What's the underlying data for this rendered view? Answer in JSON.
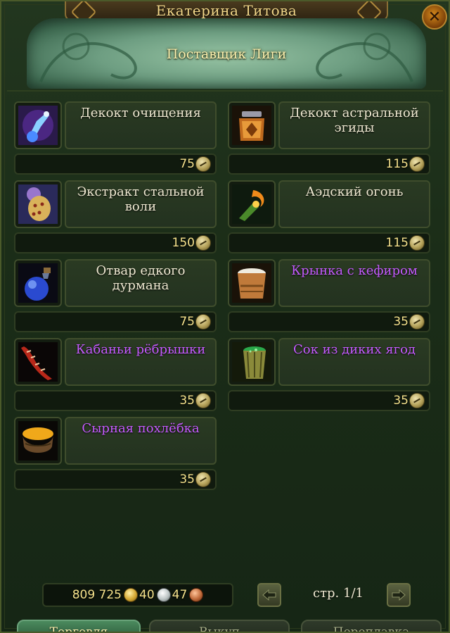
{
  "window": {
    "title": "Екатерина Титова",
    "close_icon": "close-icon"
  },
  "banner": {
    "subtitle": "Поставщик Лиги"
  },
  "items": [
    {
      "name": "Декокт очищения",
      "price": "75",
      "icon": "purifying-decoction-icon",
      "color": "#f0ead2"
    },
    {
      "name": "Декокт астральной эгиды",
      "price": "115",
      "icon": "astral-aegis-decoction-icon",
      "color": "#f0ead2"
    },
    {
      "name": "Экстракт стальной воли",
      "price": "150",
      "icon": "steel-will-extract-icon",
      "color": "#f0ead2"
    },
    {
      "name": "Аэдский огонь",
      "price": "115",
      "icon": "hellfire-icon",
      "color": "#f0ead2"
    },
    {
      "name": "Отвар едкого дурмана",
      "price": "75",
      "icon": "caustic-datura-brew-icon",
      "color": "#f0ead2"
    },
    {
      "name": "Крынка с кефиром",
      "price": "35",
      "icon": "kefir-jug-icon",
      "color": "#c65cff"
    },
    {
      "name": "Кабаньи рёбрышки",
      "price": "35",
      "icon": "boar-ribs-icon",
      "color": "#c65cff"
    },
    {
      "name": "Сок из диких ягод",
      "price": "35",
      "icon": "wild-berry-juice-icon",
      "color": "#c65cff"
    },
    {
      "name": "Сырная похлёбка",
      "price": "35",
      "icon": "cheese-soup-icon",
      "color": "#c65cff"
    }
  ],
  "currency": {
    "gold": "809 725",
    "silver": "40",
    "copper": "47"
  },
  "pagination": {
    "label": "стр. 1/1"
  },
  "tabs": [
    {
      "label": "Торговля",
      "active": true
    },
    {
      "label": "Выкуп",
      "active": false
    },
    {
      "label": "Переплавка",
      "active": false
    }
  ]
}
